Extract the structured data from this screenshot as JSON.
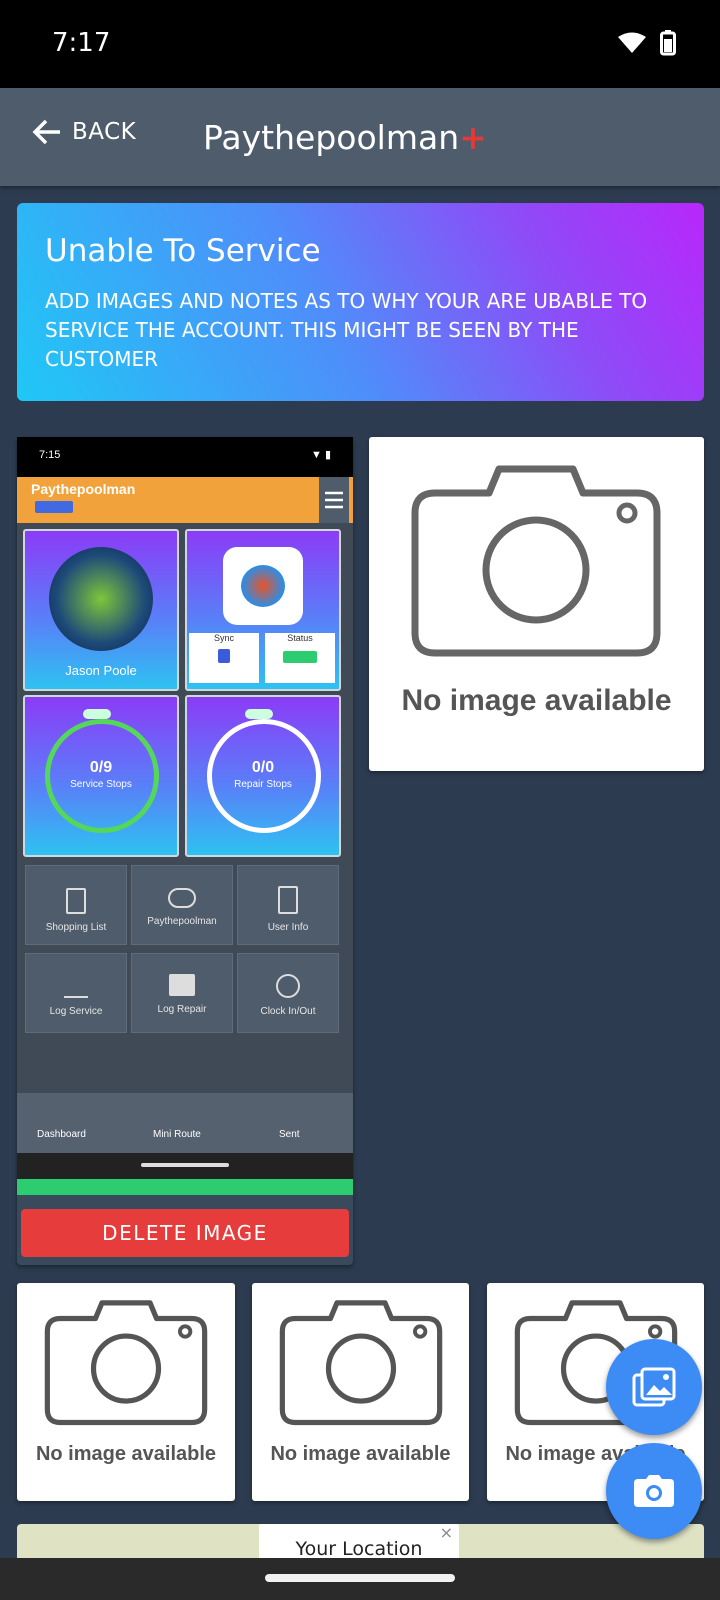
{
  "status_bar": {
    "time": "7:17"
  },
  "app_bar": {
    "back_label": "BACK",
    "title": "Paythepoolman",
    "title_plus": "+"
  },
  "banner": {
    "title": "Unable To Service",
    "text": "ADD IMAGES AND NOTES AS TO WHY YOUR ARE UBABLE TO SERVICE THE ACCOUNT. THIS MIGHT BE SEEN BY THE CUSTOMER"
  },
  "photo_card": {
    "delete_label": "DELETE IMAGE",
    "thumbnail": {
      "time": "7:15",
      "app_name": "Paythepoolman",
      "tiles": [
        "Jason Poole",
        "Service Stops",
        "Repair Stops"
      ],
      "service_count": "0/9",
      "repair_count": "0/0",
      "sync_label": "Sync",
      "status_label": "Status",
      "actions": [
        "Shopping List",
        "Paythepoolman",
        "User Info",
        "Log Service",
        "Log Repair",
        "Clock In/Out"
      ],
      "bottom_nav": [
        "Dashboard",
        "Mini Route",
        "Sent"
      ]
    }
  },
  "placeholders": {
    "label": "No image available"
  },
  "map": {
    "location_label": "Your Location",
    "close_symbol": "×"
  }
}
